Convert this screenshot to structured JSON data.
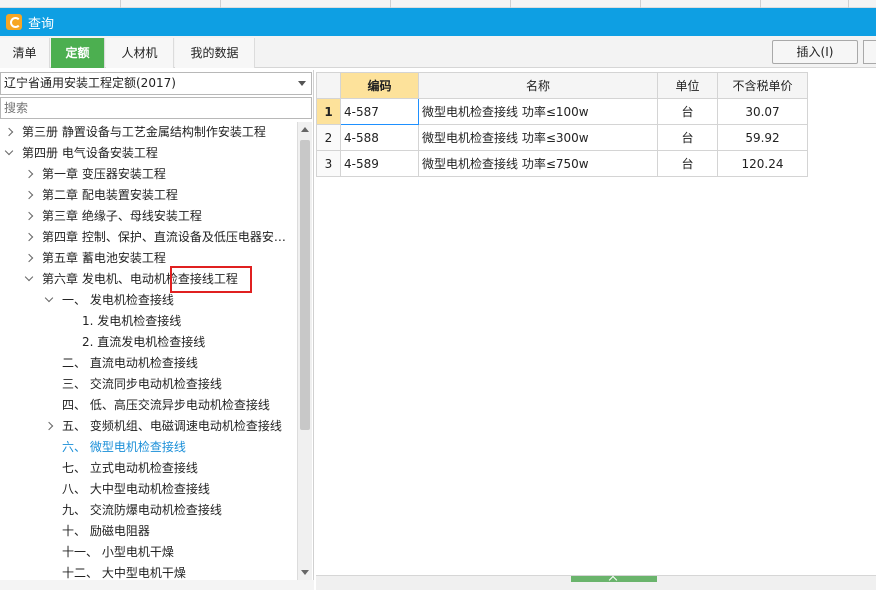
{
  "window": {
    "title": "查询"
  },
  "tabs": [
    {
      "label": "清单",
      "active": false
    },
    {
      "label": "定额",
      "active": true
    },
    {
      "label": "人材机",
      "active": false
    },
    {
      "label": "我的数据",
      "active": false
    }
  ],
  "toolbar": {
    "insert_label": "插入(I)"
  },
  "left": {
    "library_select": "辽宁省通用安装工程定额(2017)",
    "search_placeholder": "搜索",
    "tree": [
      {
        "label": "第三册 静置设备与工艺金属结构制作安装工程",
        "level": 0,
        "expander": "collapsed"
      },
      {
        "label": "第四册 电气设备安装工程",
        "level": 0,
        "expander": "expanded"
      },
      {
        "label": "第一章 变压器安装工程",
        "level": 1,
        "expander": "collapsed"
      },
      {
        "label": "第二章 配电装置安装工程",
        "level": 1,
        "expander": "collapsed"
      },
      {
        "label": "第三章 绝缘子、母线安装工程",
        "level": 1,
        "expander": "collapsed"
      },
      {
        "label": "第四章 控制、保护、直流设备及低压电器安…",
        "level": 1,
        "expander": "collapsed"
      },
      {
        "label": "第五章 蓄电池安装工程",
        "level": 1,
        "expander": "collapsed"
      },
      {
        "label": "第六章 发电机、电动机检查接线工程",
        "level": 1,
        "expander": "expanded"
      },
      {
        "label": "一、 发电机检查接线",
        "level": 2,
        "expander": "expanded"
      },
      {
        "label": "1. 发电机检查接线",
        "level": 3,
        "expander": "none"
      },
      {
        "label": "2. 直流发电机检查接线",
        "level": 3,
        "expander": "none"
      },
      {
        "label": "二、 直流电动机检查接线",
        "level": 2,
        "expander": "none"
      },
      {
        "label": "三、 交流同步电动机检查接线",
        "level": 2,
        "expander": "none"
      },
      {
        "label": "四、 低、高压交流异步电动机检查接线",
        "level": 2,
        "expander": "none"
      },
      {
        "label": "五、 变频机组、电磁调速电动机检查接线",
        "level": 2,
        "expander": "collapsed"
      },
      {
        "label": "六、 微型电机检查接线",
        "level": 2,
        "expander": "none",
        "selected": true
      },
      {
        "label": "七、 立式电动机检查接线",
        "level": 2,
        "expander": "none"
      },
      {
        "label": "八、 大中型电动机检查接线",
        "level": 2,
        "expander": "none"
      },
      {
        "label": "九、 交流防爆电动机检查接线",
        "level": 2,
        "expander": "none"
      },
      {
        "label": "十、 励磁电阻器",
        "level": 2,
        "expander": "none"
      },
      {
        "label": "十一、 小型电机干燥",
        "level": 2,
        "expander": "none"
      },
      {
        "label": "十二、 大中型电机干燥",
        "level": 2,
        "expander": "none"
      }
    ]
  },
  "grid": {
    "columns": [
      "",
      "编码",
      "名称",
      "单位",
      "不含税单价"
    ],
    "rows": [
      {
        "no": "1",
        "code": "4-587",
        "name": "微型电机检查接线 功率≤100w",
        "unit": "台",
        "price": "30.07"
      },
      {
        "no": "2",
        "code": "4-588",
        "name": "微型电机检查接线 功率≤300w",
        "unit": "台",
        "price": "59.92"
      },
      {
        "no": "3",
        "code": "4-589",
        "name": "微型电机检查接线 功率≤750w",
        "unit": "台",
        "price": "120.24"
      }
    ]
  },
  "colors": {
    "titlebar": "#0e9fe3",
    "active_tab": "#4caf50",
    "selected_text": "#1a8fd8",
    "highlight": "#e02020",
    "sorted_header": "#fde29b"
  }
}
